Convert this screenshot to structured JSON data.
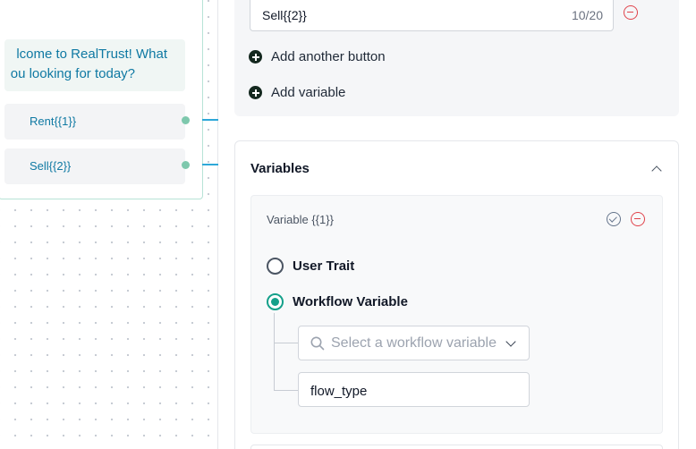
{
  "canvas": {
    "node": {
      "message_line1": "lcome to RealTrust! What",
      "message_line2": "ou looking for today?",
      "buttons": [
        {
          "label": "Rent{{1}}"
        },
        {
          "label": "Sell{{2}}"
        }
      ]
    }
  },
  "panel": {
    "button_input": {
      "value": "Sell{{2}}",
      "counter": "10/20"
    },
    "add_button_label": "Add another button",
    "add_variable_label": "Add variable",
    "variables": {
      "title": "Variables",
      "variable_name": "Variable {{1}}",
      "options": [
        {
          "label": "User Trait",
          "selected": false
        },
        {
          "label": "Workflow Variable",
          "selected": true
        }
      ],
      "select_placeholder": "Select a workflow variable",
      "selected_value": "flow_type"
    }
  },
  "colors": {
    "accent": "#14a08a",
    "link_text": "#0f79a3",
    "edge": "#2ea8d8",
    "danger": "#e0434b"
  },
  "icons": {
    "remove": "minus-circle-icon",
    "confirm": "check-circle-icon",
    "add": "plus-circle-icon",
    "collapse": "chevron-up-icon",
    "search": "search-icon",
    "dropdown": "chevron-down-icon"
  }
}
